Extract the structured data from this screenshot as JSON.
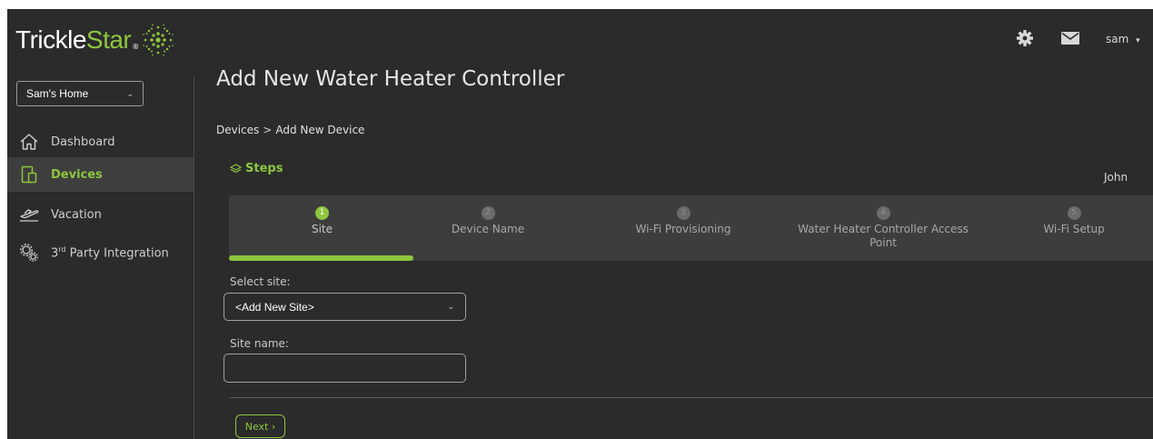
{
  "brand": {
    "name_part1": "Trickle",
    "name_part2": "Star",
    "trademark": "®"
  },
  "sidebar": {
    "home_select": "Sam's Home",
    "items": [
      {
        "label": "Dashboard",
        "icon": "home-icon"
      },
      {
        "label": "Devices",
        "icon": "devices-icon",
        "active": true
      },
      {
        "label": "Vacation",
        "icon": "plane-icon"
      },
      {
        "label_prefix": "3",
        "label_sup": "rd",
        "label_suffix": " Party Integration",
        "icon": "gears-icon"
      }
    ]
  },
  "header": {
    "user": "sam",
    "icons": [
      "gear-icon",
      "mail-icon"
    ]
  },
  "page": {
    "title": "Add New Water Heater Controller",
    "breadcrumb": {
      "parent": "Devices",
      "separator": ">",
      "current": "Add New Device"
    }
  },
  "steps": {
    "title": "Steps",
    "user": "John",
    "progress_fraction": 0.2,
    "items": [
      {
        "num": "1",
        "label": "Site",
        "active": true
      },
      {
        "num": "2",
        "label": "Device Name"
      },
      {
        "num": "3",
        "label": "Wi-Fi Provisioning"
      },
      {
        "num": "4",
        "label_line1": "Water Heater Controller Access",
        "label_line2": "Point"
      },
      {
        "num": "5",
        "label": "Wi-Fi Setup"
      }
    ]
  },
  "form": {
    "site_label": "Select site:",
    "site_value": "<Add New Site>",
    "site_name_label": "Site name:",
    "site_name_value": "",
    "next_label": "Next",
    "next_arrow": "›"
  },
  "colors": {
    "accent": "#8dc63f",
    "background": "#2b2b2b",
    "panel": "#3d3d3d"
  }
}
